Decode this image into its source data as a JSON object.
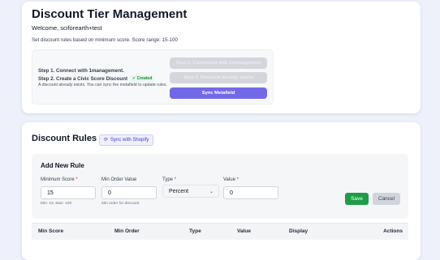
{
  "header": {
    "title": "Discount Tier Management",
    "welcome": "Welcome, sciforearth+test",
    "range_text": "Set discount rules based on minimum score. Score range: 15-100"
  },
  "steps": {
    "step1": "Step 1. Connect with 1management.",
    "step2": "Step 2. Create a Civic Score Discount",
    "step2_badge": "✓ Created",
    "note": "A discount already exists. You can sync the metafield to update rules.",
    "btn_connected": "Step 1. Connected with 1management",
    "btn_exists": "Step 2. Discount already exists",
    "btn_sync": "Sync Metafield"
  },
  "rules": {
    "title": "Discount Rules",
    "sync_shopify": "Sync with Shopify",
    "sync_icon": "refresh-icon"
  },
  "add_rule": {
    "title": "Add New Rule",
    "min_score_label": "Minimum Score",
    "min_score_value": "15",
    "min_score_help": "Min: 15, Max: 100",
    "min_order_label": "Min Order Value",
    "min_order_value": "0",
    "min_order_help": "Min order for discount",
    "type_label": "Type",
    "type_value": "Percent",
    "value_label": "Value",
    "value_value": "0",
    "required_mark": "*",
    "save": "Save",
    "cancel": "Cancel"
  },
  "table": {
    "headers": [
      "Min Score",
      "Min Order",
      "Type",
      "Value",
      "Display",
      "Actions"
    ]
  },
  "colors": {
    "accent": "#7369e8",
    "save": "#1f9d45",
    "badge": "#218a44"
  }
}
